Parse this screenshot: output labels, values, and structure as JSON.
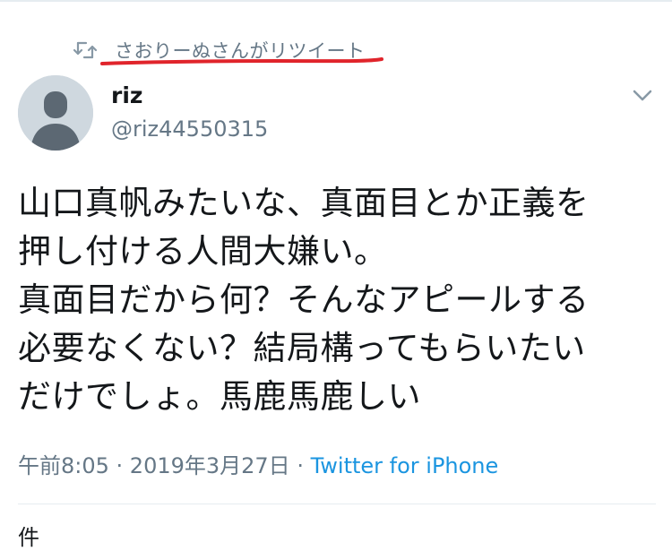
{
  "retweet": {
    "icon": "retweet-icon",
    "label": "さおりーぬさんがリツイート",
    "annotation_color": "#e0242b"
  },
  "author": {
    "name": "riz",
    "handle": "@riz44550315",
    "avatar": "default-avatar"
  },
  "tweet": {
    "lines": [
      "山口真帆みたいな、真面目とか正義を",
      "押し付ける人間大嫌い。",
      "真面目だから何？そんなアピールする",
      "必要なくない？結局構ってもらいたい",
      "だけでしょ。馬鹿馬鹿しい"
    ]
  },
  "meta": {
    "time": "午前8:05",
    "sep1": " · ",
    "date": "2019年3月27日",
    "sep2": " · ",
    "source": "Twitter for iPhone"
  },
  "stats": {
    "partial_text": "件"
  },
  "colors": {
    "text": "#14171a",
    "muted": "#657786",
    "link": "#1b95e0"
  }
}
